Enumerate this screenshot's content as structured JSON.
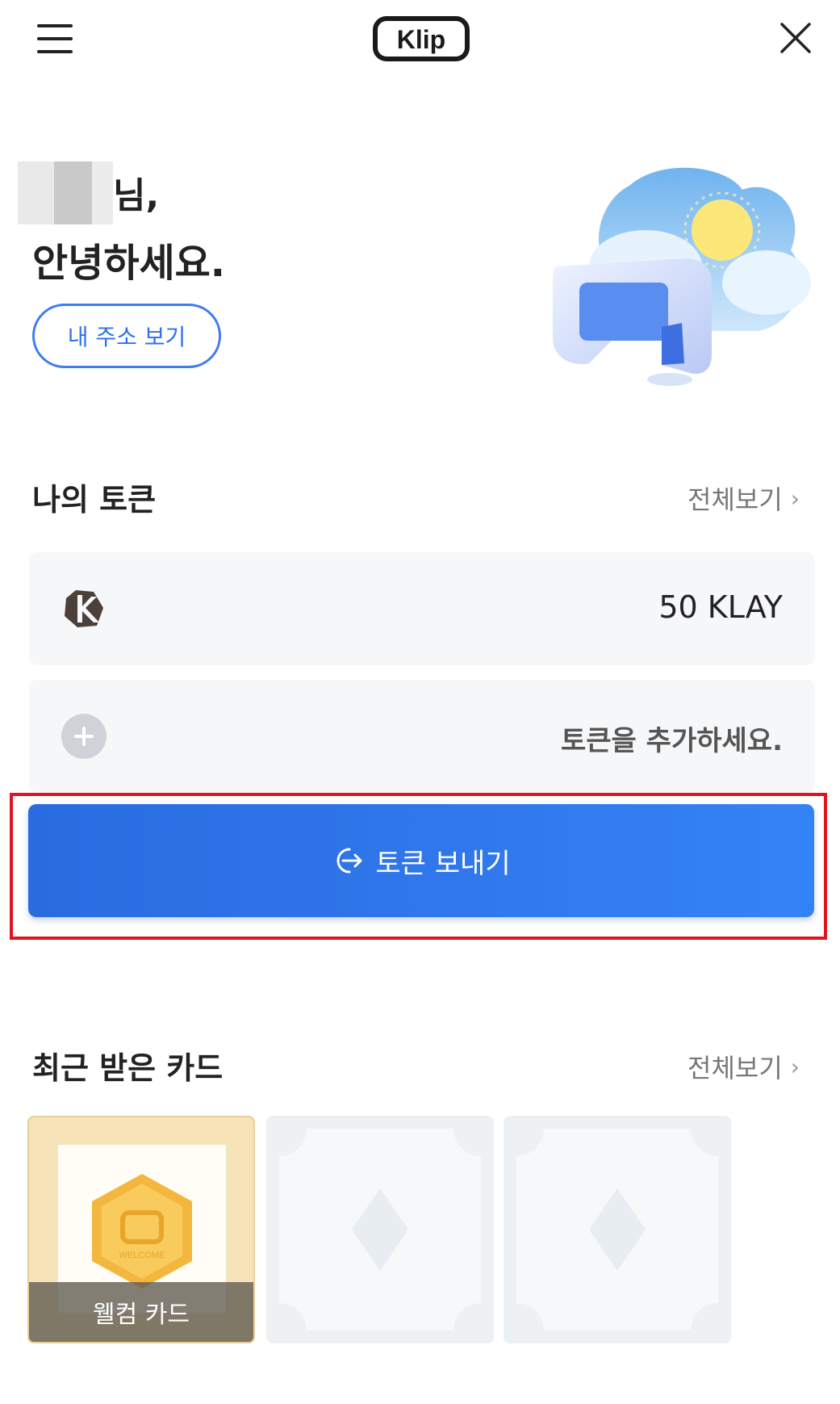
{
  "header": {
    "logo_text": "Klip",
    "menu_icon": "hamburger-menu-icon",
    "close_icon": "close-icon"
  },
  "greeting": {
    "name_suffix": "님,",
    "hello": "안녕하세요.",
    "address_button": "내 주소 보기"
  },
  "tokens": {
    "title": "나의 토큰",
    "view_all": "전체보기",
    "items": [
      {
        "amount": "50 KLAY",
        "icon": "klay-logo-icon"
      }
    ],
    "add_prompt": "토큰을 추가하세요.",
    "send_button": "토큰 보내기"
  },
  "cards": {
    "title": "최근 받은 카드",
    "view_all": "전체보기",
    "items": [
      {
        "label": "웰컴 카드",
        "badge_text": "WELCOME"
      }
    ]
  },
  "colors": {
    "accent_blue": "#2f72e8",
    "highlight_red": "#e0141e",
    "card_gold": "#f3b740"
  }
}
